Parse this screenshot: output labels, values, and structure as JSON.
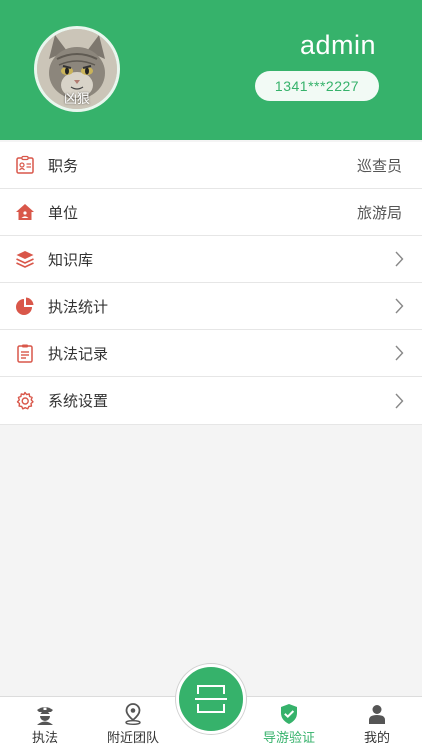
{
  "profile": {
    "avatar_caption": "凶狠",
    "username": "admin",
    "phone": "1341***2227"
  },
  "menu": {
    "items": [
      {
        "label": "职务",
        "value": "巡查员",
        "icon": "id-card-icon"
      },
      {
        "label": "单位",
        "value": "旅游局",
        "icon": "home-icon"
      },
      {
        "label": "知识库",
        "value": "",
        "icon": "layers-icon"
      },
      {
        "label": "执法统计",
        "value": "",
        "icon": "pie-chart-icon"
      },
      {
        "label": "执法记录",
        "value": "",
        "icon": "clipboard-icon"
      },
      {
        "label": "系统设置",
        "value": "",
        "icon": "gear-icon"
      }
    ]
  },
  "tabbar": {
    "tabs": [
      {
        "label": "执法",
        "icon": "officer-icon",
        "active": false
      },
      {
        "label": "附近团队",
        "icon": "map-pin-icon",
        "active": false
      },
      {
        "label": "导游验证",
        "icon": "shield-check-icon",
        "active": true
      },
      {
        "label": "我的",
        "icon": "user-icon",
        "active": false
      }
    ],
    "scan_icon": "scan-icon"
  },
  "colors": {
    "brand_green": "#36b26b",
    "icon_red": "#d9574a"
  }
}
